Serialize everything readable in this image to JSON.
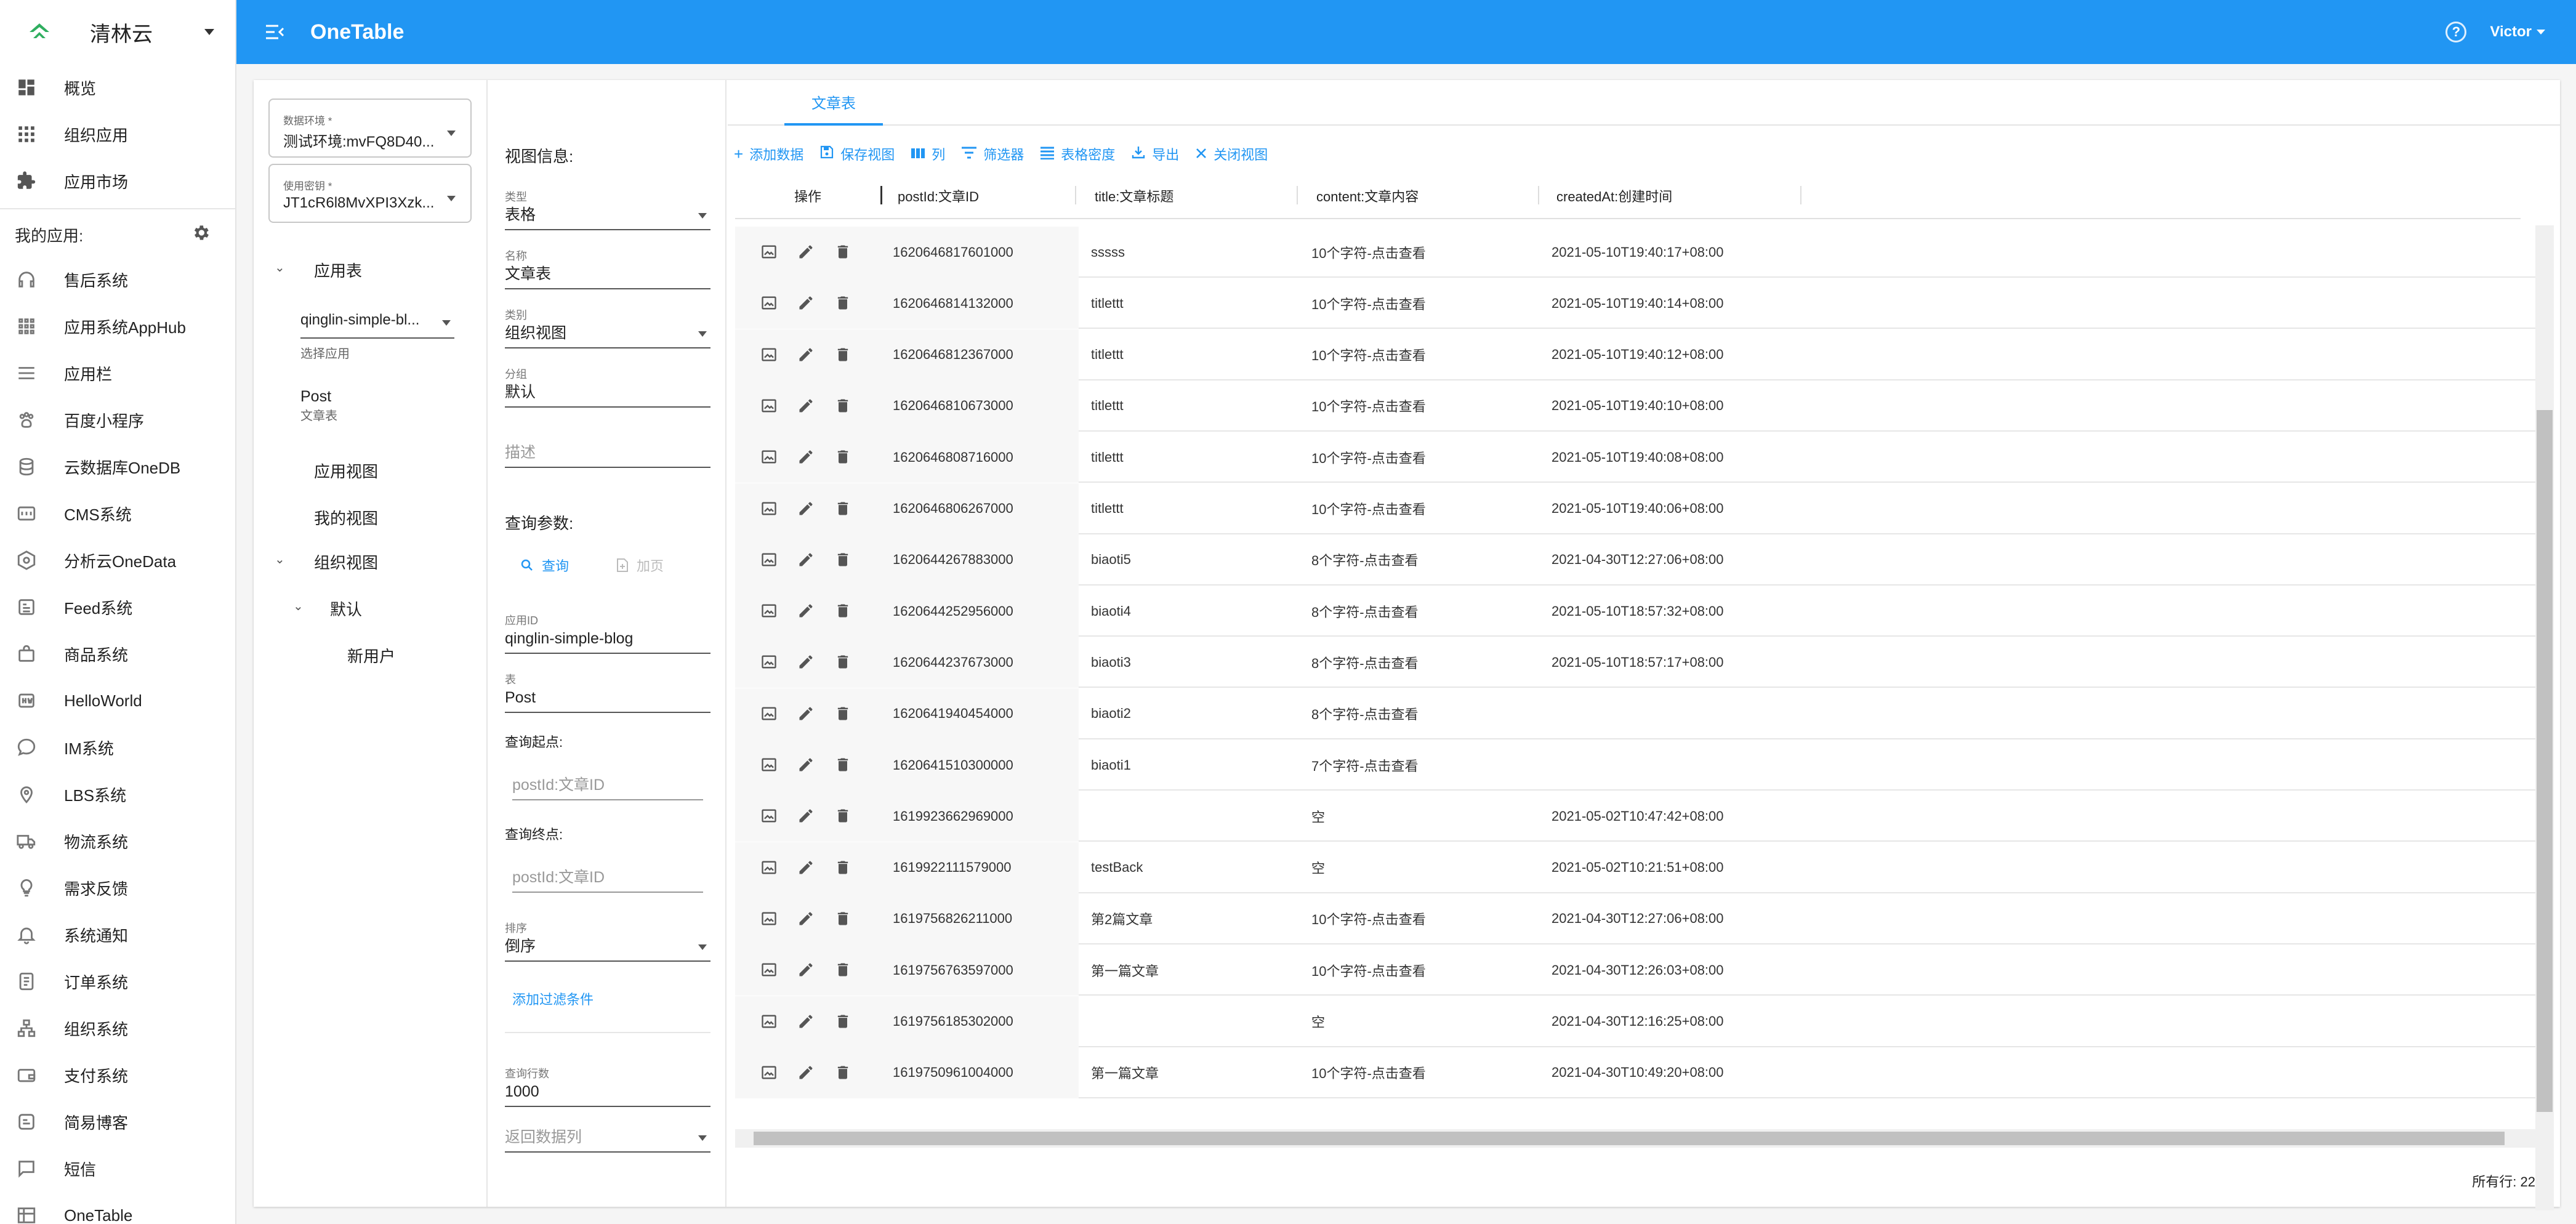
{
  "brand": {
    "name": "清林云"
  },
  "topbar": {
    "title": "OneTable",
    "user": "Victor"
  },
  "sidebar": {
    "top_items": [
      {
        "label": "概览",
        "icon": "dashboard-icon"
      },
      {
        "label": "组织应用",
        "icon": "apps-grid-icon"
      },
      {
        "label": "应用市场",
        "icon": "puzzle-icon"
      }
    ],
    "my_apps_label": "我的应用:",
    "apps": [
      {
        "label": "售后系统",
        "icon": "headset-icon"
      },
      {
        "label": "应用系统AppHub",
        "icon": "apps-grid-icon"
      },
      {
        "label": "应用栏",
        "icon": "bars-icon"
      },
      {
        "label": "百度小程序",
        "icon": "paw-icon"
      },
      {
        "label": "云数据库OneDB",
        "icon": "database-icon"
      },
      {
        "label": "CMS系统",
        "icon": "cms-icon"
      },
      {
        "label": "分析云OneData",
        "icon": "hexagon-icon"
      },
      {
        "label": "Feed系统",
        "icon": "feed-icon"
      },
      {
        "label": "商品系统",
        "icon": "bag-icon"
      },
      {
        "label": "HelloWorld",
        "icon": "hw-icon"
      },
      {
        "label": "IM系统",
        "icon": "chat-icon"
      },
      {
        "label": "LBS系统",
        "icon": "location-icon"
      },
      {
        "label": "物流系统",
        "icon": "truck-icon"
      },
      {
        "label": "需求反馈",
        "icon": "bulb-icon"
      },
      {
        "label": "系统通知",
        "icon": "bell-icon"
      },
      {
        "label": "订单系统",
        "icon": "order-icon"
      },
      {
        "label": "组织系统",
        "icon": "org-icon"
      },
      {
        "label": "支付系统",
        "icon": "wallet-icon"
      },
      {
        "label": "简易博客",
        "icon": "blog-icon"
      },
      {
        "label": "短信",
        "icon": "sms-icon"
      },
      {
        "label": "OneTable",
        "icon": "table-icon"
      }
    ]
  },
  "env": {
    "label": "数据环境 *",
    "value": "测试环境:mvFQ8D40...",
    "key_label": "使用密钥 *",
    "key_value": "JT1cR6l8MvXPI3Xzk..."
  },
  "tree": {
    "app_table": "应用表",
    "app_select": "qinglin-simple-bl...",
    "app_select_hint": "选择应用",
    "post": "Post",
    "post_sub": "文章表",
    "app_view": "应用视图",
    "my_view": "我的视图",
    "org_view": "组织视图",
    "default": "默认",
    "new_user": "新用户"
  },
  "view_info": {
    "heading": "视图信息:",
    "type_label": "类型",
    "type_value": "表格",
    "name_label": "名称",
    "name_value": "文章表",
    "category_label": "类别",
    "category_value": "组织视图",
    "group_label": "分组",
    "group_value": "默认",
    "desc_placeholder": "描述"
  },
  "query": {
    "heading": "查询参数:",
    "query_btn": "查询",
    "load_btn": "加页",
    "app_id_label": "应用ID",
    "app_id_value": "qinglin-simple-blog",
    "table_label": "表",
    "table_value": "Post",
    "start_label": "查询起点:",
    "start_placeholder": "postId:文章ID",
    "end_label": "查询终点:",
    "end_placeholder": "postId:文章ID",
    "sort_label": "排序",
    "sort_value": "倒序",
    "add_filter": "添加过滤条件",
    "rows_label": "查询行数",
    "rows_value": "1000",
    "return_cols": "返回数据列"
  },
  "tab": {
    "label": "文章表"
  },
  "toolbar": {
    "add": "添加数据",
    "save_view": "保存视图",
    "columns": "列",
    "filter": "筛选器",
    "density": "表格密度",
    "export": "导出",
    "close_view": "关闭视图"
  },
  "table": {
    "headers": {
      "actions": "操作",
      "postId": "postId:文章ID",
      "title": "title:文章标题",
      "content": "content:文章内容",
      "createdAt": "createdAt:创建时间"
    },
    "rows": [
      {
        "postId": "1620646817601000",
        "title": "sssss",
        "content": "10个字符-点击查看",
        "createdAt": "2021-05-10T19:40:17+08:00"
      },
      {
        "postId": "1620646814132000",
        "title": "titlettt",
        "content": "10个字符-点击查看",
        "createdAt": "2021-05-10T19:40:14+08:00"
      },
      {
        "postId": "1620646812367000",
        "title": "titlettt",
        "content": "10个字符-点击查看",
        "createdAt": "2021-05-10T19:40:12+08:00"
      },
      {
        "postId": "1620646810673000",
        "title": "titlettt",
        "content": "10个字符-点击查看",
        "createdAt": "2021-05-10T19:40:10+08:00"
      },
      {
        "postId": "1620646808716000",
        "title": "titlettt",
        "content": "10个字符-点击查看",
        "createdAt": "2021-05-10T19:40:08+08:00"
      },
      {
        "postId": "1620646806267000",
        "title": "titlettt",
        "content": "10个字符-点击查看",
        "createdAt": "2021-05-10T19:40:06+08:00"
      },
      {
        "postId": "1620644267883000",
        "title": "biaoti5",
        "content": "8个字符-点击查看",
        "createdAt": "2021-04-30T12:27:06+08:00"
      },
      {
        "postId": "1620644252956000",
        "title": "biaoti4",
        "content": "8个字符-点击查看",
        "createdAt": "2021-05-10T18:57:32+08:00"
      },
      {
        "postId": "1620644237673000",
        "title": "biaoti3",
        "content": "8个字符-点击查看",
        "createdAt": "2021-05-10T18:57:17+08:00"
      },
      {
        "postId": "1620641940454000",
        "title": "biaoti2",
        "content": "8个字符-点击查看",
        "createdAt": ""
      },
      {
        "postId": "1620641510300000",
        "title": "biaoti1",
        "content": "7个字符-点击查看",
        "createdAt": ""
      },
      {
        "postId": "1619923662969000",
        "title": "",
        "content": "空",
        "createdAt": "2021-05-02T10:47:42+08:00"
      },
      {
        "postId": "1619922111579000",
        "title": "testBack",
        "content": "空",
        "createdAt": "2021-05-02T10:21:51+08:00"
      },
      {
        "postId": "1619756826211000",
        "title": "第2篇文章",
        "content": "10个字符-点击查看",
        "createdAt": "2021-04-30T12:27:06+08:00"
      },
      {
        "postId": "1619756763597000",
        "title": "第一篇文章",
        "content": "10个字符-点击查看",
        "createdAt": "2021-04-30T12:26:03+08:00"
      },
      {
        "postId": "1619756185302000",
        "title": "",
        "content": "空",
        "createdAt": "2021-04-30T12:16:25+08:00"
      },
      {
        "postId": "1619750961004000",
        "title": "第一篇文章",
        "content": "10个字符-点击查看",
        "createdAt": "2021-04-30T10:49:20+08:00"
      }
    ],
    "row_count": "所有行: 22"
  },
  "colors": {
    "primary": "#2196f3",
    "brand_logo": "#2fae5f"
  }
}
